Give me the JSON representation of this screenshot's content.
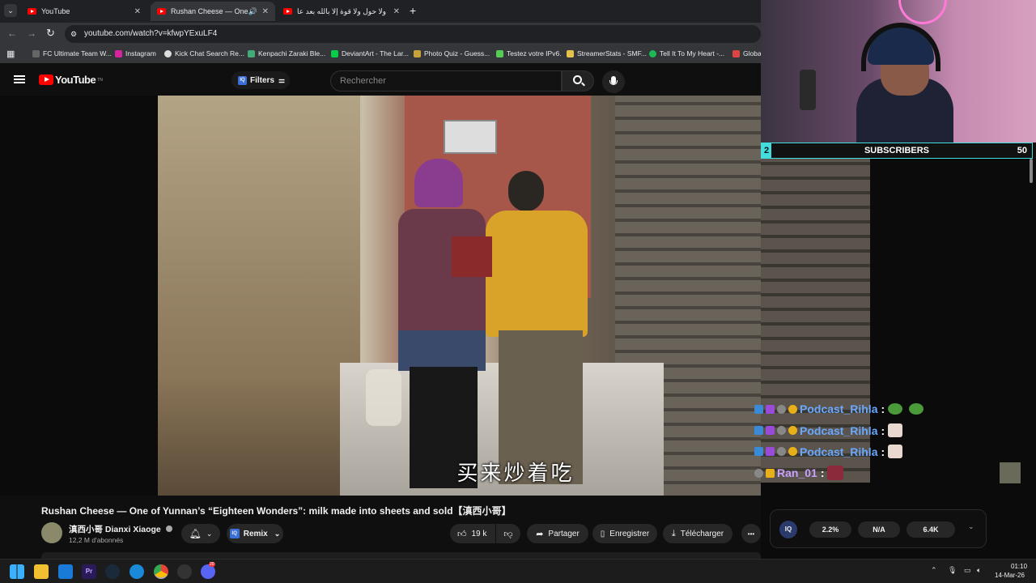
{
  "browser": {
    "tabs": [
      {
        "label": "YouTube",
        "active": false
      },
      {
        "label": "Rushan Cheese — One of Y",
        "active": true
      },
      {
        "label": "ولا حول ولا قوة إلا بالله بعد عامين",
        "active": false
      }
    ],
    "new_tab": "+",
    "url": "youtube.com/watch?v=kfwpYExuLF4",
    "bookmarks": [
      "FC Ultimate Team W...",
      "Instagram",
      "Kick Chat Search Re...",
      "Kenpachi Zaraki Ble...",
      "DeviantArt - The Lar...",
      "Photo Quiz - Guess...",
      "Testez votre IPv6.",
      "StreamerStats - SMF...",
      "Tell It To My Heart -...",
      "Globa"
    ]
  },
  "youtube": {
    "logo_text": "YouTube",
    "logo_sup": "TN",
    "filters_label": "Filters",
    "search_placeholder": "Rechercher",
    "subtitle": "买来炒着吃",
    "video_title": "Rushan Cheese — One of Yunnan’s “Eighteen Wonders”: milk made into sheets and sold【滇西小哥】",
    "channel_name": "滇西小哥 Dianxi Xiaoge",
    "subscribers": "12,2 M d'abonnés",
    "remix_label": "Remix",
    "likes": "19 k",
    "share_label": "Partager",
    "save_label": "Enregistrer",
    "download_label": "Télécharger",
    "more_label": "•••"
  },
  "extension": {
    "badge": "IQ",
    "stats": [
      "2.2%",
      "N/A",
      "6.4K"
    ]
  },
  "overlay": {
    "sub_goal_left": "2",
    "sub_goal_label": "SUBSCRIBERS",
    "sub_goal_right": "50",
    "chat": [
      {
        "user": "Podcast_Rihla",
        "sep": ":",
        "color": "#6aa8ff"
      },
      {
        "user": "Podcast_Rihla",
        "sep": ":",
        "color": "#6aa8ff"
      },
      {
        "user": "Podcast_Rihla",
        "sep": ":",
        "color": "#6aa8ff"
      },
      {
        "user": "Ran_01",
        "sep": ":",
        "color": "#c8a0ff"
      }
    ]
  },
  "taskbar": {
    "clock_time": "01:10",
    "clock_date": "14-Mar-26",
    "notification_count": "20"
  }
}
